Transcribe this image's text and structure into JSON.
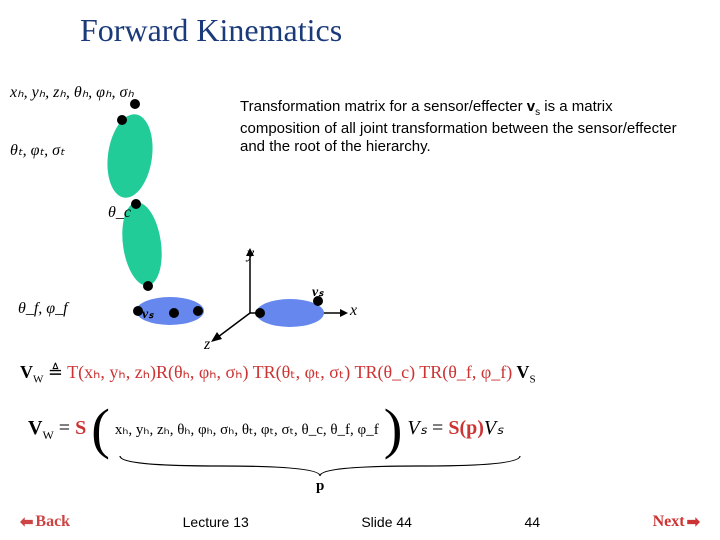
{
  "title": "Forward Kinematics",
  "body": {
    "line1a": "Transformation matrix for a sensor/effecter ",
    "line1b": " is a matrix composition of all joint transformation between the sensor/effecter and the root of the hierarchy.",
    "vs": "v",
    "vs_sub": "s"
  },
  "params": {
    "hip": "xₕ, yₕ, zₕ, θₕ, φₕ, σₕ",
    "thigh": "θₜ, φₜ, σₜ",
    "calf": "θ_c",
    "foot": "θ_f, φ_f"
  },
  "axes": {
    "x": "x",
    "y": "y",
    "z": "z"
  },
  "labels": {
    "vs": "vₛ",
    "vs2": "vₛ",
    "p": "p"
  },
  "equation": {
    "lhs1": "V",
    "lhs1_sub": "W",
    "def": " ≜ ",
    "t": "T(xₕ, yₕ, zₕ)R(θₕ, φₕ, σₕ) TR(θₜ, φₜ, σₜ) TR(θ_c) TR(θ_f, φ_f)",
    "vs": " V",
    "vs_sub": "S",
    "line2_lhs": "V",
    "line2_lhs_sub": "W",
    "line2_eq": " = ",
    "line2_S": "S",
    "line2_args": "xₕ, yₕ, zₕ, θₕ, φₕ, σₕ, θₜ, φₜ, σₜ, θ_c, θ_f, φ_f",
    "line2_rhs_vs": "Vₛ",
    "line2_rhs_eq": " = ",
    "line2_rhs_sp": "S(p)",
    "line2_rhs_vs2": "Vₛ"
  },
  "footer": {
    "back": "Back",
    "lecture": "Lecture 13",
    "slide": "Slide 44",
    "page": "44",
    "next": "Next"
  }
}
